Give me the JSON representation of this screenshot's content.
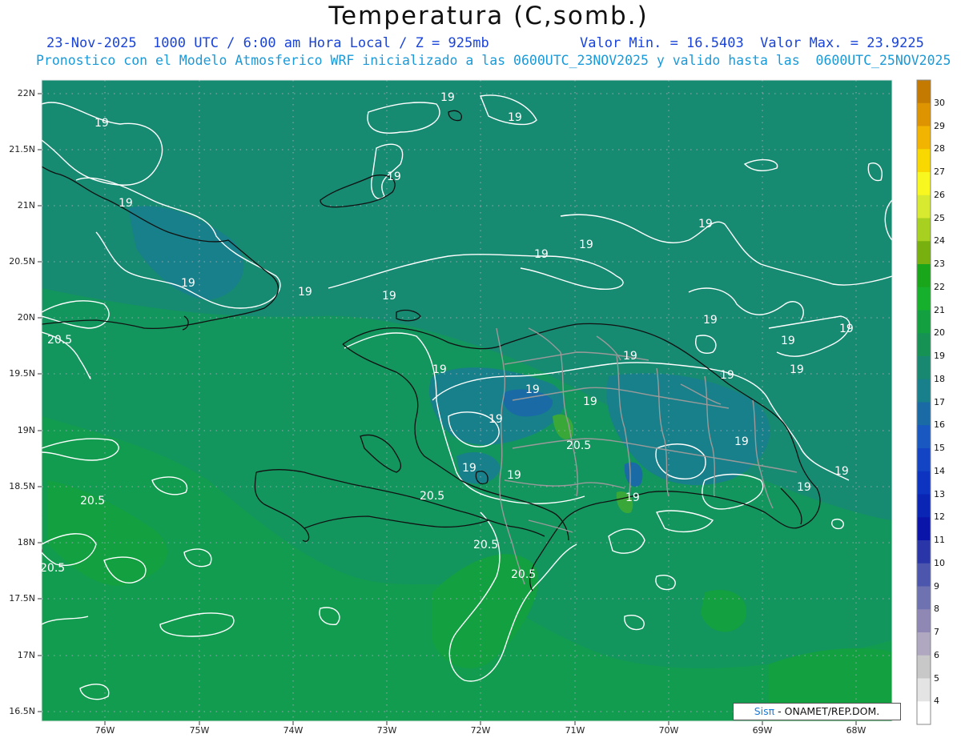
{
  "header": {
    "title": "Temperatura (C,somb.)",
    "line1_left": "23-Nov-2025  1000 UTC / 6:00 am Hora Local / Z = 925mb",
    "line1_right": "Valor Min. = 16.5403  Valor Max. = 23.9225",
    "line2": "Pronostico con el Modelo Atmosferico WRF inicializado a las 0600UTC_23NOV2025 y valido hasta las  0600UTC_25NOV2025"
  },
  "axes": {
    "lat_labels": [
      "22N",
      "21.5N",
      "21N",
      "20.5N",
      "20N",
      "19.5N",
      "19N",
      "18.5N",
      "18N",
      "17.5N",
      "17N",
      "16.5N"
    ],
    "lon_labels": [
      "76W",
      "75W",
      "74W",
      "73W",
      "72W",
      "71W",
      "70W",
      "69W",
      "68W"
    ]
  },
  "contour_labels": [
    {
      "text": "19"
    },
    {
      "text": "19"
    },
    {
      "text": "19"
    },
    {
      "text": "19"
    },
    {
      "text": "19"
    },
    {
      "text": "19"
    },
    {
      "text": "19"
    },
    {
      "text": "19"
    },
    {
      "text": "19"
    },
    {
      "text": "19"
    },
    {
      "text": "19"
    },
    {
      "text": "19"
    },
    {
      "text": "19"
    },
    {
      "text": "19"
    },
    {
      "text": "19"
    },
    {
      "text": "19"
    },
    {
      "text": "19"
    },
    {
      "text": "19"
    },
    {
      "text": "19"
    },
    {
      "text": "19"
    },
    {
      "text": "19"
    },
    {
      "text": "19"
    },
    {
      "text": "19"
    },
    {
      "text": "19"
    },
    {
      "text": "20.5"
    },
    {
      "text": "20.5"
    },
    {
      "text": "20.5"
    },
    {
      "text": "20.5"
    },
    {
      "text": "20.5"
    },
    {
      "text": "20.5"
    }
  ],
  "colorbar": {
    "labels": [
      "30",
      "29",
      "28",
      "27",
      "26",
      "25",
      "24",
      "23",
      "22",
      "21",
      "20",
      "19",
      "18",
      "17",
      "16",
      "15",
      "14",
      "13",
      "12",
      "11",
      "10",
      "9",
      "8",
      "7",
      "6",
      "5",
      "4"
    ],
    "colors": [
      "#c47a00",
      "#de9400",
      "#f2b400",
      "#f8d800",
      "#f8f820",
      "#d8ea30",
      "#a8d020",
      "#78b010",
      "#1aa61a",
      "#16b02c",
      "#12a040",
      "#169254",
      "#188870",
      "#18808a",
      "#1a6aa6",
      "#1858c0",
      "#1244c4",
      "#0c34c0",
      "#0a24b4",
      "#0a14a8",
      "#2a36a8",
      "#4c56ac",
      "#6e72b0",
      "#9088b4",
      "#b0a8c0",
      "#c8c8c8",
      "#e4e4e4",
      "#ffffff"
    ]
  },
  "credit": {
    "brand": "Sisπ",
    "text": "- ONAMET/REP.DOM."
  }
}
